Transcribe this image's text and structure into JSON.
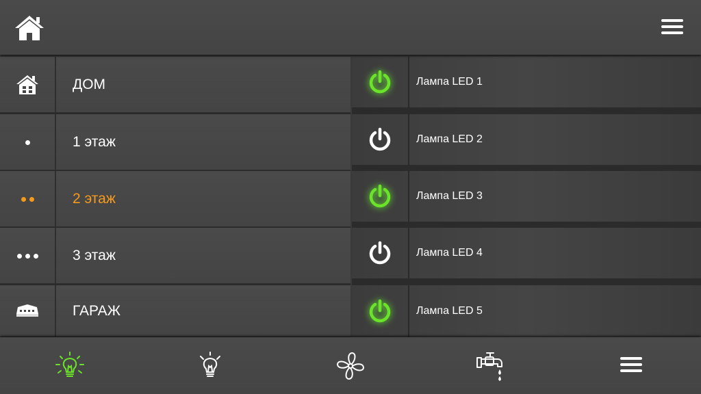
{
  "topbar": {
    "home_icon": "home-icon",
    "menu_icon": "hamburger-menu-icon"
  },
  "sidebar": {
    "active_color": "#f59a1c",
    "items": [
      {
        "label": "ДОМ",
        "icon": "house-icon"
      },
      {
        "label": "1 этаж",
        "icon": "one-dot-icon"
      },
      {
        "label": "2 этаж",
        "icon": "two-dots-icon",
        "active": true
      },
      {
        "label": "3 этаж",
        "icon": "three-dots-icon"
      },
      {
        "label": "ГАРАЖ",
        "icon": "garage-icon"
      }
    ]
  },
  "lamps": {
    "on_color": "#6be32a",
    "off_color": "#ffffff",
    "items": [
      {
        "name": "Лампа LED 1",
        "state": "on"
      },
      {
        "name": "Лампа LED 2",
        "state": "off"
      },
      {
        "name": "Лампа LED 3",
        "state": "on"
      },
      {
        "name": "Лампа LED 4",
        "state": "off"
      },
      {
        "name": "Лампа LED 5",
        "state": "on"
      }
    ]
  },
  "bottom_tabs": [
    {
      "icon": "lightbulb-icon",
      "active": true
    },
    {
      "icon": "lightbulb-outline-icon"
    },
    {
      "icon": "fan-icon"
    },
    {
      "icon": "water-tap-icon"
    },
    {
      "icon": "hamburger-menu-icon"
    }
  ]
}
